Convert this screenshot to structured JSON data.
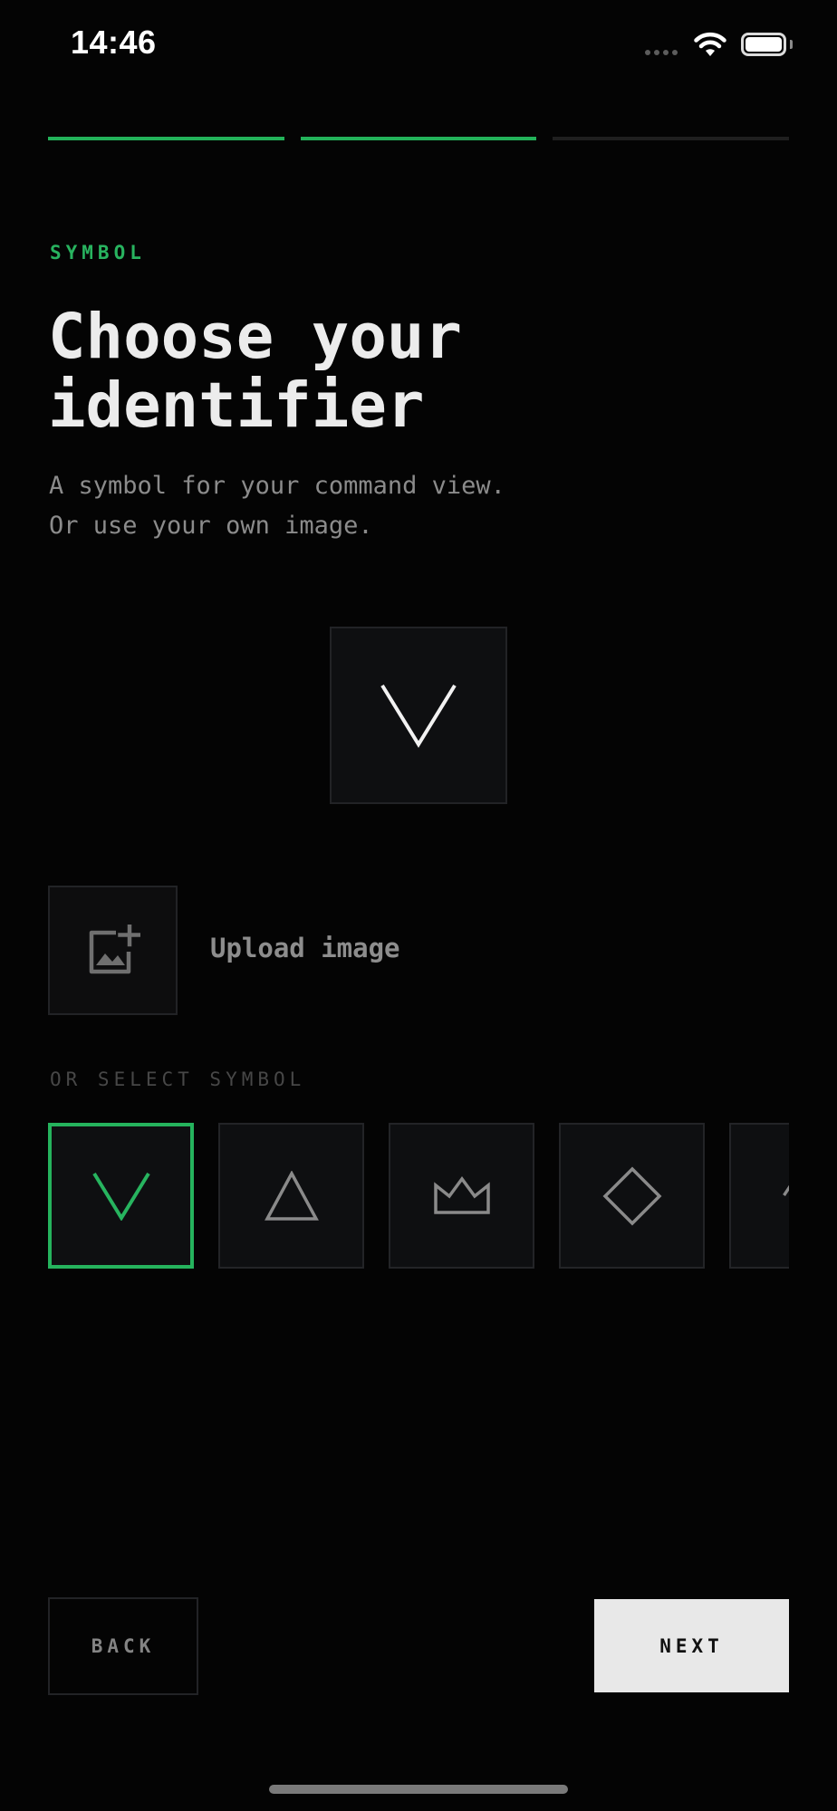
{
  "status_bar": {
    "time": "14:46",
    "signal_icon": "cellular-signal-icon",
    "wifi_icon": "wifi-icon",
    "battery_icon": "battery-icon",
    "battery_level": 1.0
  },
  "progress": {
    "total_steps": 3,
    "completed_steps": 2
  },
  "colors": {
    "accent": "#23b25a",
    "background": "#040404",
    "text_primary": "#ececec",
    "text_muted": "#8b8b8b"
  },
  "header": {
    "eyebrow": "SYMBOL",
    "title_line1": "Choose your",
    "title_line2": "identifier",
    "subtitle_line1": "A symbol for your command view.",
    "subtitle_line2": "Or use your own image."
  },
  "preview": {
    "symbol": "chevron-down-icon"
  },
  "upload": {
    "icon": "add-photo-icon",
    "label": "Upload image"
  },
  "symbols": {
    "section_label": "OR SELECT SYMBOL",
    "selected": "chevron-down-icon",
    "items": [
      "chevron-down-icon",
      "triangle-icon",
      "crown-icon",
      "diamond-icon",
      "partial-symbol-icon"
    ]
  },
  "footer": {
    "back_label": "BACK",
    "next_label": "NEXT"
  }
}
